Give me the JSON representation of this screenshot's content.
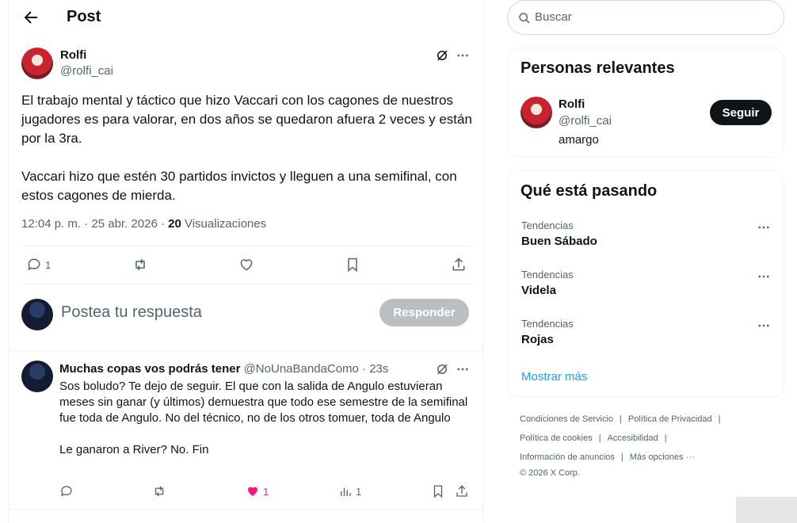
{
  "header": {
    "title": "Post"
  },
  "post": {
    "author_name": "Rolfi",
    "author_handle": "@rolfi_cai",
    "text": "El trabajo mental y táctico que hizo Vaccari con los cagones de nuestros jugadores es para valorar, en dos años se quedaron afuera 2 veces y están por la 3ra.\n\nVaccari hizo que estén 30 partidos invictos y lleguen a una semifinal, con estos cagones de mierda.",
    "time": "12:04 p. m. · 25 abr. 2026 · ",
    "views_count": "20",
    "views_label": " Visualizaciones",
    "reply_count": "1"
  },
  "composer": {
    "placeholder": "Postea tu respuesta",
    "button": "Responder"
  },
  "reply": {
    "author_name": "Muchas copas vos podrás tener",
    "author_handle": "@NoUnaBandaComo · 23s",
    "text": "Sos boludo? Te dejo de seguir. El que con la salida de Angulo estuvieran meses sin ganar (y últimos) demuestra que todo ese semestre de la semifinal fue toda de Angulo. No del técnico, no de los otros tomuer, toda de Angulo\n\nLe ganaron a River? No. Fin",
    "like_count": "1",
    "views_count": "1"
  },
  "sidebar": {
    "search_placeholder": "Buscar",
    "people_title": "Personas relevantes",
    "person_name": "Rolfi",
    "person_handle": "@rolfi_cai",
    "person_bio": "amargo",
    "follow_label": "Seguir",
    "trends_title": "Qué está pasando",
    "trends": [
      {
        "category": "Tendencias",
        "name": "Buen Sábado"
      },
      {
        "category": "Tendencias",
        "name": "Videla"
      },
      {
        "category": "Tendencias",
        "name": "Rojas"
      }
    ],
    "show_more": "Mostrar más"
  },
  "footer": {
    "terms": "Condiciones de Servicio",
    "privacy": "Política de Privacidad",
    "cookies": "Política de cookies",
    "accessibility": "Accesibilidad",
    "ads_info": "Información de anuncios",
    "more": "Más opciones ···",
    "copyright": "© 2026 X Corp."
  },
  "colors": {
    "accent": "#1d9bf0",
    "like": "#f91880",
    "muted": "#536471",
    "text": "#0f1419"
  }
}
